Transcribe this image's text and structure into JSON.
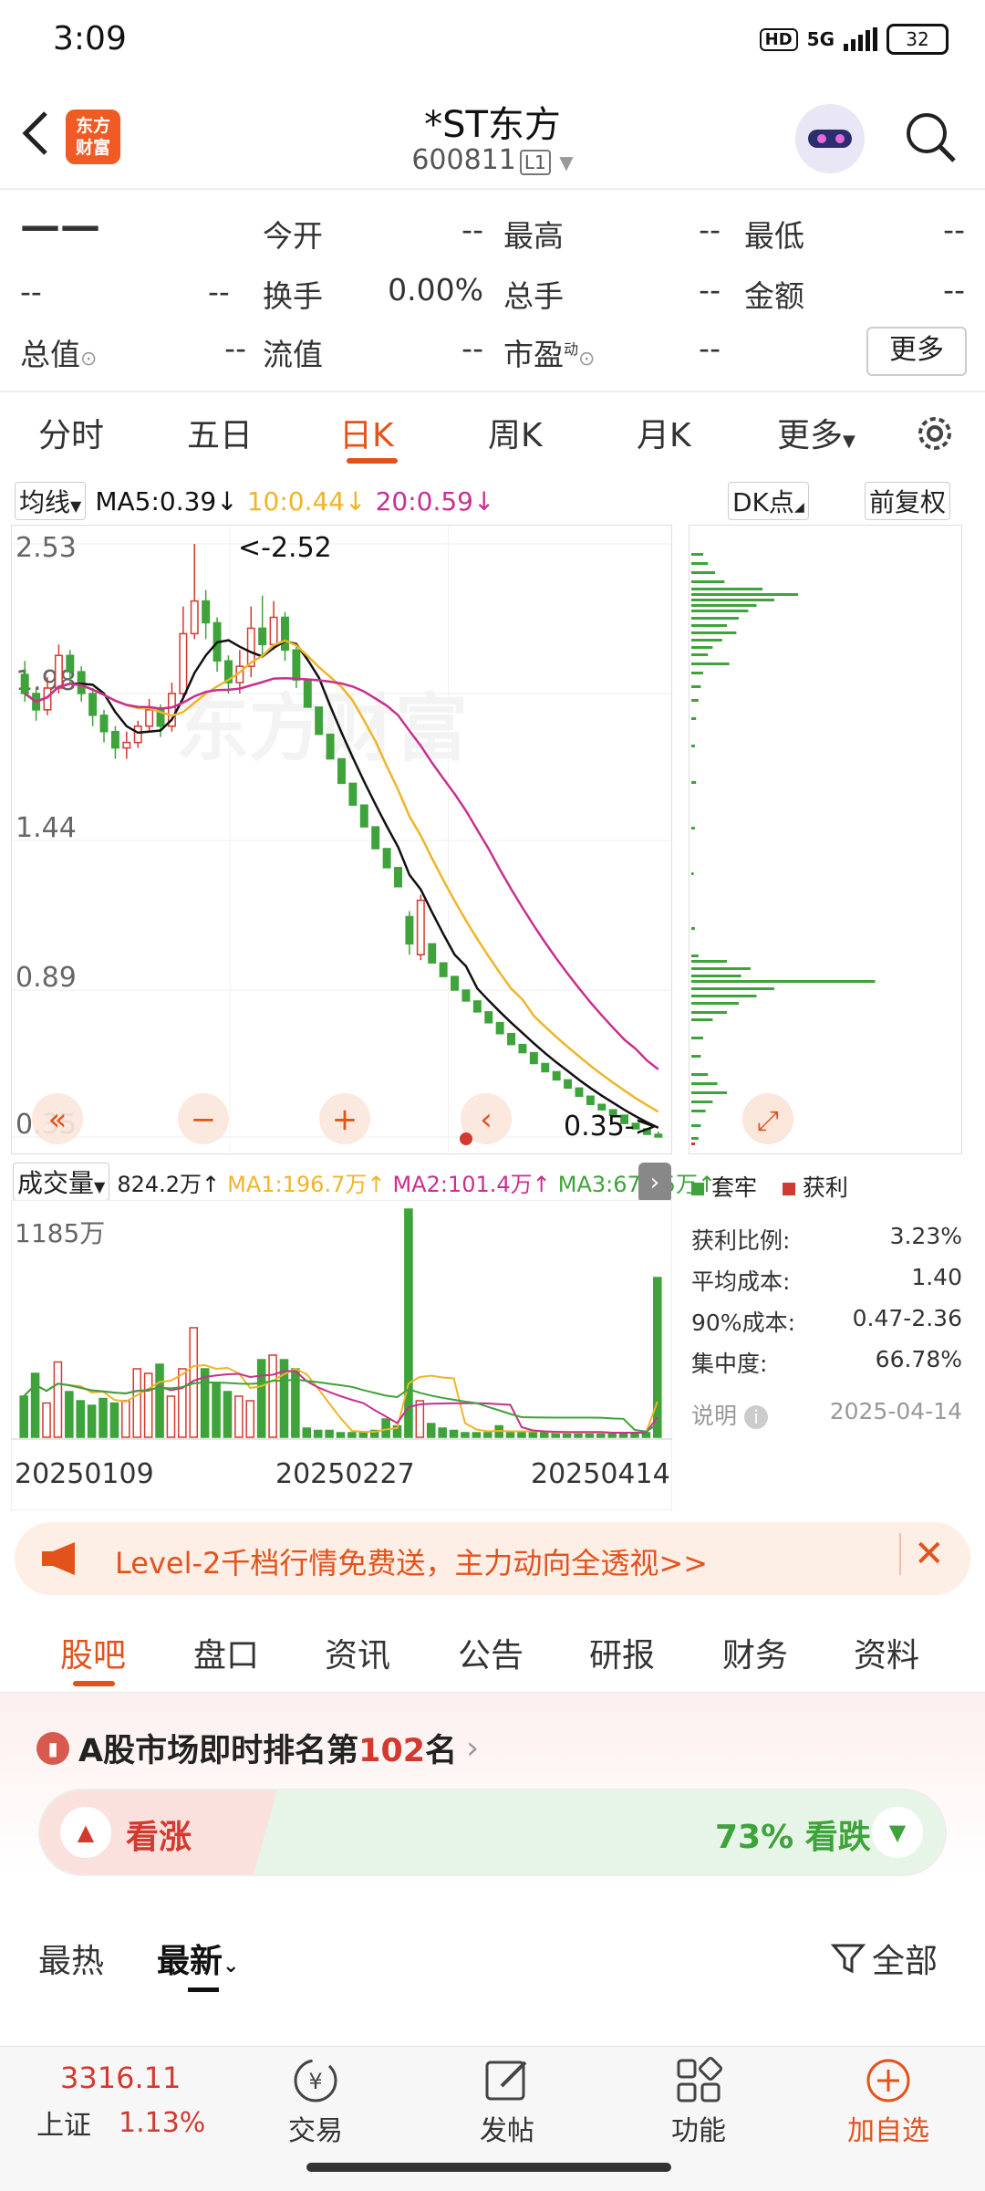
{
  "status_bar": {
    "time": "3:09",
    "hd": "HD",
    "network": "5G",
    "battery": "32"
  },
  "header": {
    "logo_line1": "东方",
    "logo_line2": "财富",
    "title": "*ST东方",
    "code": "600811",
    "level": "L1"
  },
  "quote": {
    "price": "——",
    "change": "--",
    "change_pct": "--",
    "open_label": "今开",
    "open": "--",
    "high_label": "最高",
    "high": "--",
    "low_label": "最低",
    "low": "--",
    "turnover_label": "换手",
    "turnover": "0.00%",
    "volume_label": "总手",
    "volume": "--",
    "amount_label": "金额",
    "amount": "--",
    "mktcap_label": "总值",
    "mktcap": "--",
    "float_label": "流值",
    "float": "--",
    "pe_label": "市盈",
    "pe_sup": "动",
    "pe": "--",
    "more": "更多"
  },
  "tabs": [
    "分时",
    "五日",
    "日K",
    "周K",
    "月K",
    "更多"
  ],
  "active_tab": "日K",
  "chart_header": {
    "ma_selector": "均线",
    "ma5": "MA5:0.39",
    "ma10": "10:0.44",
    "ma20": "20:0.59",
    "dk": "DK点",
    "adjust": "前复权"
  },
  "colors": {
    "up": "#d23a2f",
    "down": "#3ea33a",
    "ma5": "#111111",
    "ma10": "#f0b429",
    "ma20": "#c8308f",
    "accent": "#e2531c"
  },
  "chart_data": {
    "type": "candlestick",
    "y_ticks": [
      "2.53",
      "1.98",
      "1.44",
      "0.89",
      "0.35"
    ],
    "annotations": [
      "<-2.52",
      "0.35->"
    ],
    "ylim": [
      0.35,
      2.53
    ],
    "x_ticks": [
      "20250109",
      "20250227",
      "20250414"
    ],
    "candles": [
      [
        2.05,
        1.98,
        2.1,
        1.95
      ],
      [
        1.98,
        1.92,
        2.0,
        1.88
      ],
      [
        1.92,
        2.0,
        2.04,
        1.9
      ],
      [
        2.0,
        2.12,
        2.16,
        1.98
      ],
      [
        2.12,
        2.06,
        2.14,
        2.02
      ],
      [
        2.06,
        1.98,
        2.08,
        1.95
      ],
      [
        1.98,
        1.9,
        2.0,
        1.86
      ],
      [
        1.9,
        1.84,
        1.92,
        1.8
      ],
      [
        1.84,
        1.78,
        1.86,
        1.74
      ],
      [
        1.78,
        1.8,
        1.84,
        1.74
      ],
      [
        1.8,
        1.86,
        1.88,
        1.78
      ],
      [
        1.86,
        1.92,
        1.96,
        1.84
      ],
      [
        1.92,
        1.86,
        1.94,
        1.82
      ],
      [
        1.86,
        1.98,
        2.02,
        1.84
      ],
      [
        1.98,
        2.2,
        2.3,
        1.96
      ],
      [
        2.2,
        2.32,
        2.53,
        2.18
      ],
      [
        2.32,
        2.24,
        2.36,
        2.18
      ],
      [
        2.24,
        2.1,
        2.26,
        2.06
      ],
      [
        2.1,
        2.02,
        2.12,
        1.98
      ],
      [
        2.02,
        2.08,
        2.14,
        1.98
      ],
      [
        2.08,
        2.22,
        2.3,
        2.04
      ],
      [
        2.22,
        2.16,
        2.34,
        2.12
      ],
      [
        2.16,
        2.26,
        2.32,
        2.14
      ],
      [
        2.26,
        2.14,
        2.28,
        2.1
      ],
      [
        2.14,
        2.03,
        2.16,
        2.0
      ],
      [
        2.03,
        1.93,
        2.03,
        1.93
      ],
      [
        1.93,
        1.83,
        1.93,
        1.83
      ],
      [
        1.83,
        1.74,
        1.83,
        1.74
      ],
      [
        1.74,
        1.65,
        1.74,
        1.65
      ],
      [
        1.65,
        1.57,
        1.65,
        1.57
      ],
      [
        1.57,
        1.49,
        1.57,
        1.49
      ],
      [
        1.49,
        1.41,
        1.49,
        1.41
      ],
      [
        1.41,
        1.34,
        1.41,
        1.34
      ],
      [
        1.34,
        1.27,
        1.34,
        1.27
      ],
      [
        1.16,
        1.06,
        1.18,
        1.02
      ],
      [
        1.02,
        1.22,
        1.24,
        1.0
      ],
      [
        1.06,
        0.99,
        1.06,
        0.99
      ],
      [
        0.99,
        0.94,
        0.99,
        0.94
      ],
      [
        0.94,
        0.89,
        0.94,
        0.89
      ],
      [
        0.89,
        0.85,
        0.89,
        0.85
      ],
      [
        0.85,
        0.81,
        0.85,
        0.81
      ],
      [
        0.81,
        0.77,
        0.81,
        0.77
      ],
      [
        0.77,
        0.73,
        0.77,
        0.73
      ],
      [
        0.73,
        0.69,
        0.73,
        0.69
      ],
      [
        0.69,
        0.66,
        0.69,
        0.66
      ],
      [
        0.66,
        0.62,
        0.66,
        0.62
      ],
      [
        0.62,
        0.59,
        0.62,
        0.59
      ],
      [
        0.59,
        0.56,
        0.59,
        0.56
      ],
      [
        0.56,
        0.53,
        0.56,
        0.53
      ],
      [
        0.53,
        0.5,
        0.53,
        0.5
      ],
      [
        0.5,
        0.47,
        0.5,
        0.47
      ],
      [
        0.47,
        0.45,
        0.47,
        0.45
      ],
      [
        0.45,
        0.43,
        0.45,
        0.43
      ],
      [
        0.43,
        0.4,
        0.43,
        0.4
      ],
      [
        0.4,
        0.38,
        0.4,
        0.38
      ],
      [
        0.38,
        0.36,
        0.38,
        0.36
      ],
      [
        0.36,
        0.35,
        0.37,
        0.35
      ]
    ]
  },
  "volume": {
    "label": "成交量",
    "current": "824.2万",
    "ma1": "MA1:196.7万",
    "ma2": "MA2:101.4万",
    "ma3": "MA3:67.95万",
    "max": "1185万",
    "bars": [
      0.18,
      0.28,
      0.15,
      0.33,
      0.2,
      0.16,
      0.14,
      0.17,
      0.15,
      0.16,
      0.3,
      0.28,
      0.32,
      0.18,
      0.3,
      0.48,
      0.3,
      0.24,
      0.2,
      0.18,
      0.16,
      0.34,
      0.36,
      0.34,
      0.3,
      0.04,
      0.03,
      0.03,
      0.02,
      0.02,
      0.02,
      0.03,
      0.08,
      0.05,
      1.0,
      0.16,
      0.06,
      0.04,
      0.03,
      0.02,
      0.02,
      0.02,
      0.05,
      0.02,
      0.02,
      0.02,
      0.02,
      0.02,
      0.02,
      0.02,
      0.02,
      0.02,
      0.02,
      0.02,
      0.02,
      0.02,
      0.7
    ]
  },
  "chip": {
    "legend_trapped": "套牢",
    "legend_profit": "获利",
    "profit_ratio_label": "获利比例:",
    "profit_ratio": "3.23%",
    "avg_cost_label": "平均成本:",
    "avg_cost": "1.40",
    "cost90_label": "90%成本:",
    "cost90": "0.47-2.36",
    "concentration_label": "集中度:",
    "concentration": "66.78%",
    "note_label": "说明",
    "date": "2025-04-14"
  },
  "banner": {
    "text": "Level-2千档行情免费送，主力动向全透视>>"
  },
  "section_tabs": [
    "股吧",
    "盘口",
    "资讯",
    "公告",
    "研报",
    "财务",
    "资料"
  ],
  "active_section": "股吧",
  "ranking": {
    "prefix": "A股市场即时排名第",
    "rank": "102",
    "suffix": "名"
  },
  "vote": {
    "up_label": "看涨",
    "down_label": "73% 看跌"
  },
  "feed_filters": {
    "hot": "最热",
    "latest": "最新",
    "all": "全部"
  },
  "bottom_nav": {
    "index_value": "3316.11",
    "index_name": "上证",
    "index_change": "1.13%",
    "trade": "交易",
    "post": "发帖",
    "functions": "功能",
    "add_watch": "加自选"
  }
}
